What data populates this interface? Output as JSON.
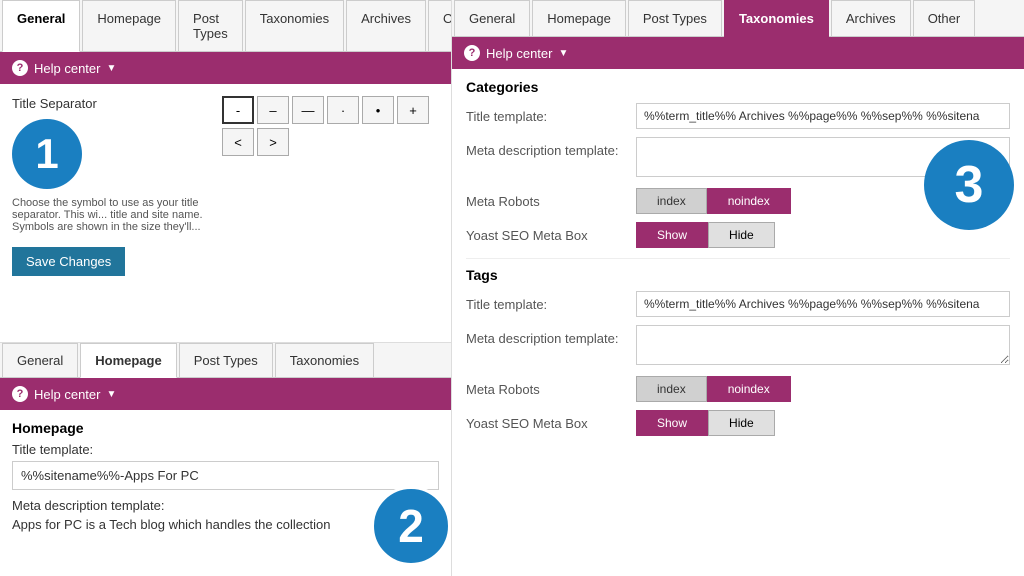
{
  "left": {
    "tabs": [
      {
        "label": "General",
        "active": false
      },
      {
        "label": "Homepage",
        "active": false
      },
      {
        "label": "Post Types",
        "active": false
      },
      {
        "label": "Taxonomies",
        "active": false
      },
      {
        "label": "Archives",
        "active": false
      },
      {
        "label": "Other",
        "active": false
      }
    ],
    "help_bar": "Help center",
    "title_separator_label": "Title Separator",
    "separators": [
      "-",
      "–",
      "—",
      "·",
      "•",
      "+"
    ],
    "arrows": [
      "<",
      ">"
    ],
    "helper_text": "Choose the symbol to use as your title separator. This wi... title and site name. Symbols are shown in the size they'll...",
    "save_btn": "Save Changes",
    "circle1": "1",
    "second_tabs": [
      {
        "label": "General",
        "active": false
      },
      {
        "label": "Homepage",
        "active": true
      },
      {
        "label": "Post Types",
        "active": false
      },
      {
        "label": "Taxonomies",
        "active": false
      }
    ],
    "second_help_bar": "Help center",
    "homepage_label": "Homepage",
    "title_template_label": "Title template:",
    "title_template_value": "%%sitename%%-Apps For PC",
    "meta_desc_label": "Meta description template:",
    "meta_desc_value": "Apps for PC is a Tech blog which handles the collection",
    "circle2": "2"
  },
  "right": {
    "tabs": [
      {
        "label": "General",
        "active": false
      },
      {
        "label": "Homepage",
        "active": false
      },
      {
        "label": "Post Types",
        "active": false
      },
      {
        "label": "Taxonomies",
        "active": true
      },
      {
        "label": "Archives",
        "active": false
      },
      {
        "label": "Other",
        "active": false
      }
    ],
    "help_bar": "Help center",
    "categories_title": "Categories",
    "cat_title_template_label": "Title template:",
    "cat_title_template_value": "%%term_title%% Archives %%page%% %%sep%% %%sitena",
    "cat_meta_desc_label": "Meta description template:",
    "cat_meta_robots_label": "Meta Robots",
    "cat_index_btn": "index",
    "cat_noindex_btn": "noindex",
    "cat_yoast_label": "Yoast SEO Meta Box",
    "cat_show_btn": "Show",
    "cat_hide_btn": "Hide",
    "tags_title": "Tags",
    "tags_title_template_label": "Title template:",
    "tags_title_template_value": "%%term_title%% Archives %%page%% %%sep%% %%sitena",
    "tags_meta_desc_label": "Meta description template:",
    "tags_meta_robots_label": "Meta Robots",
    "tags_index_btn": "index",
    "tags_noindex_btn": "noindex",
    "tags_yoast_label": "Yoast SEO Meta Box",
    "tags_show_btn": "Show",
    "tags_hide_btn": "Hide",
    "circle3": "3"
  }
}
